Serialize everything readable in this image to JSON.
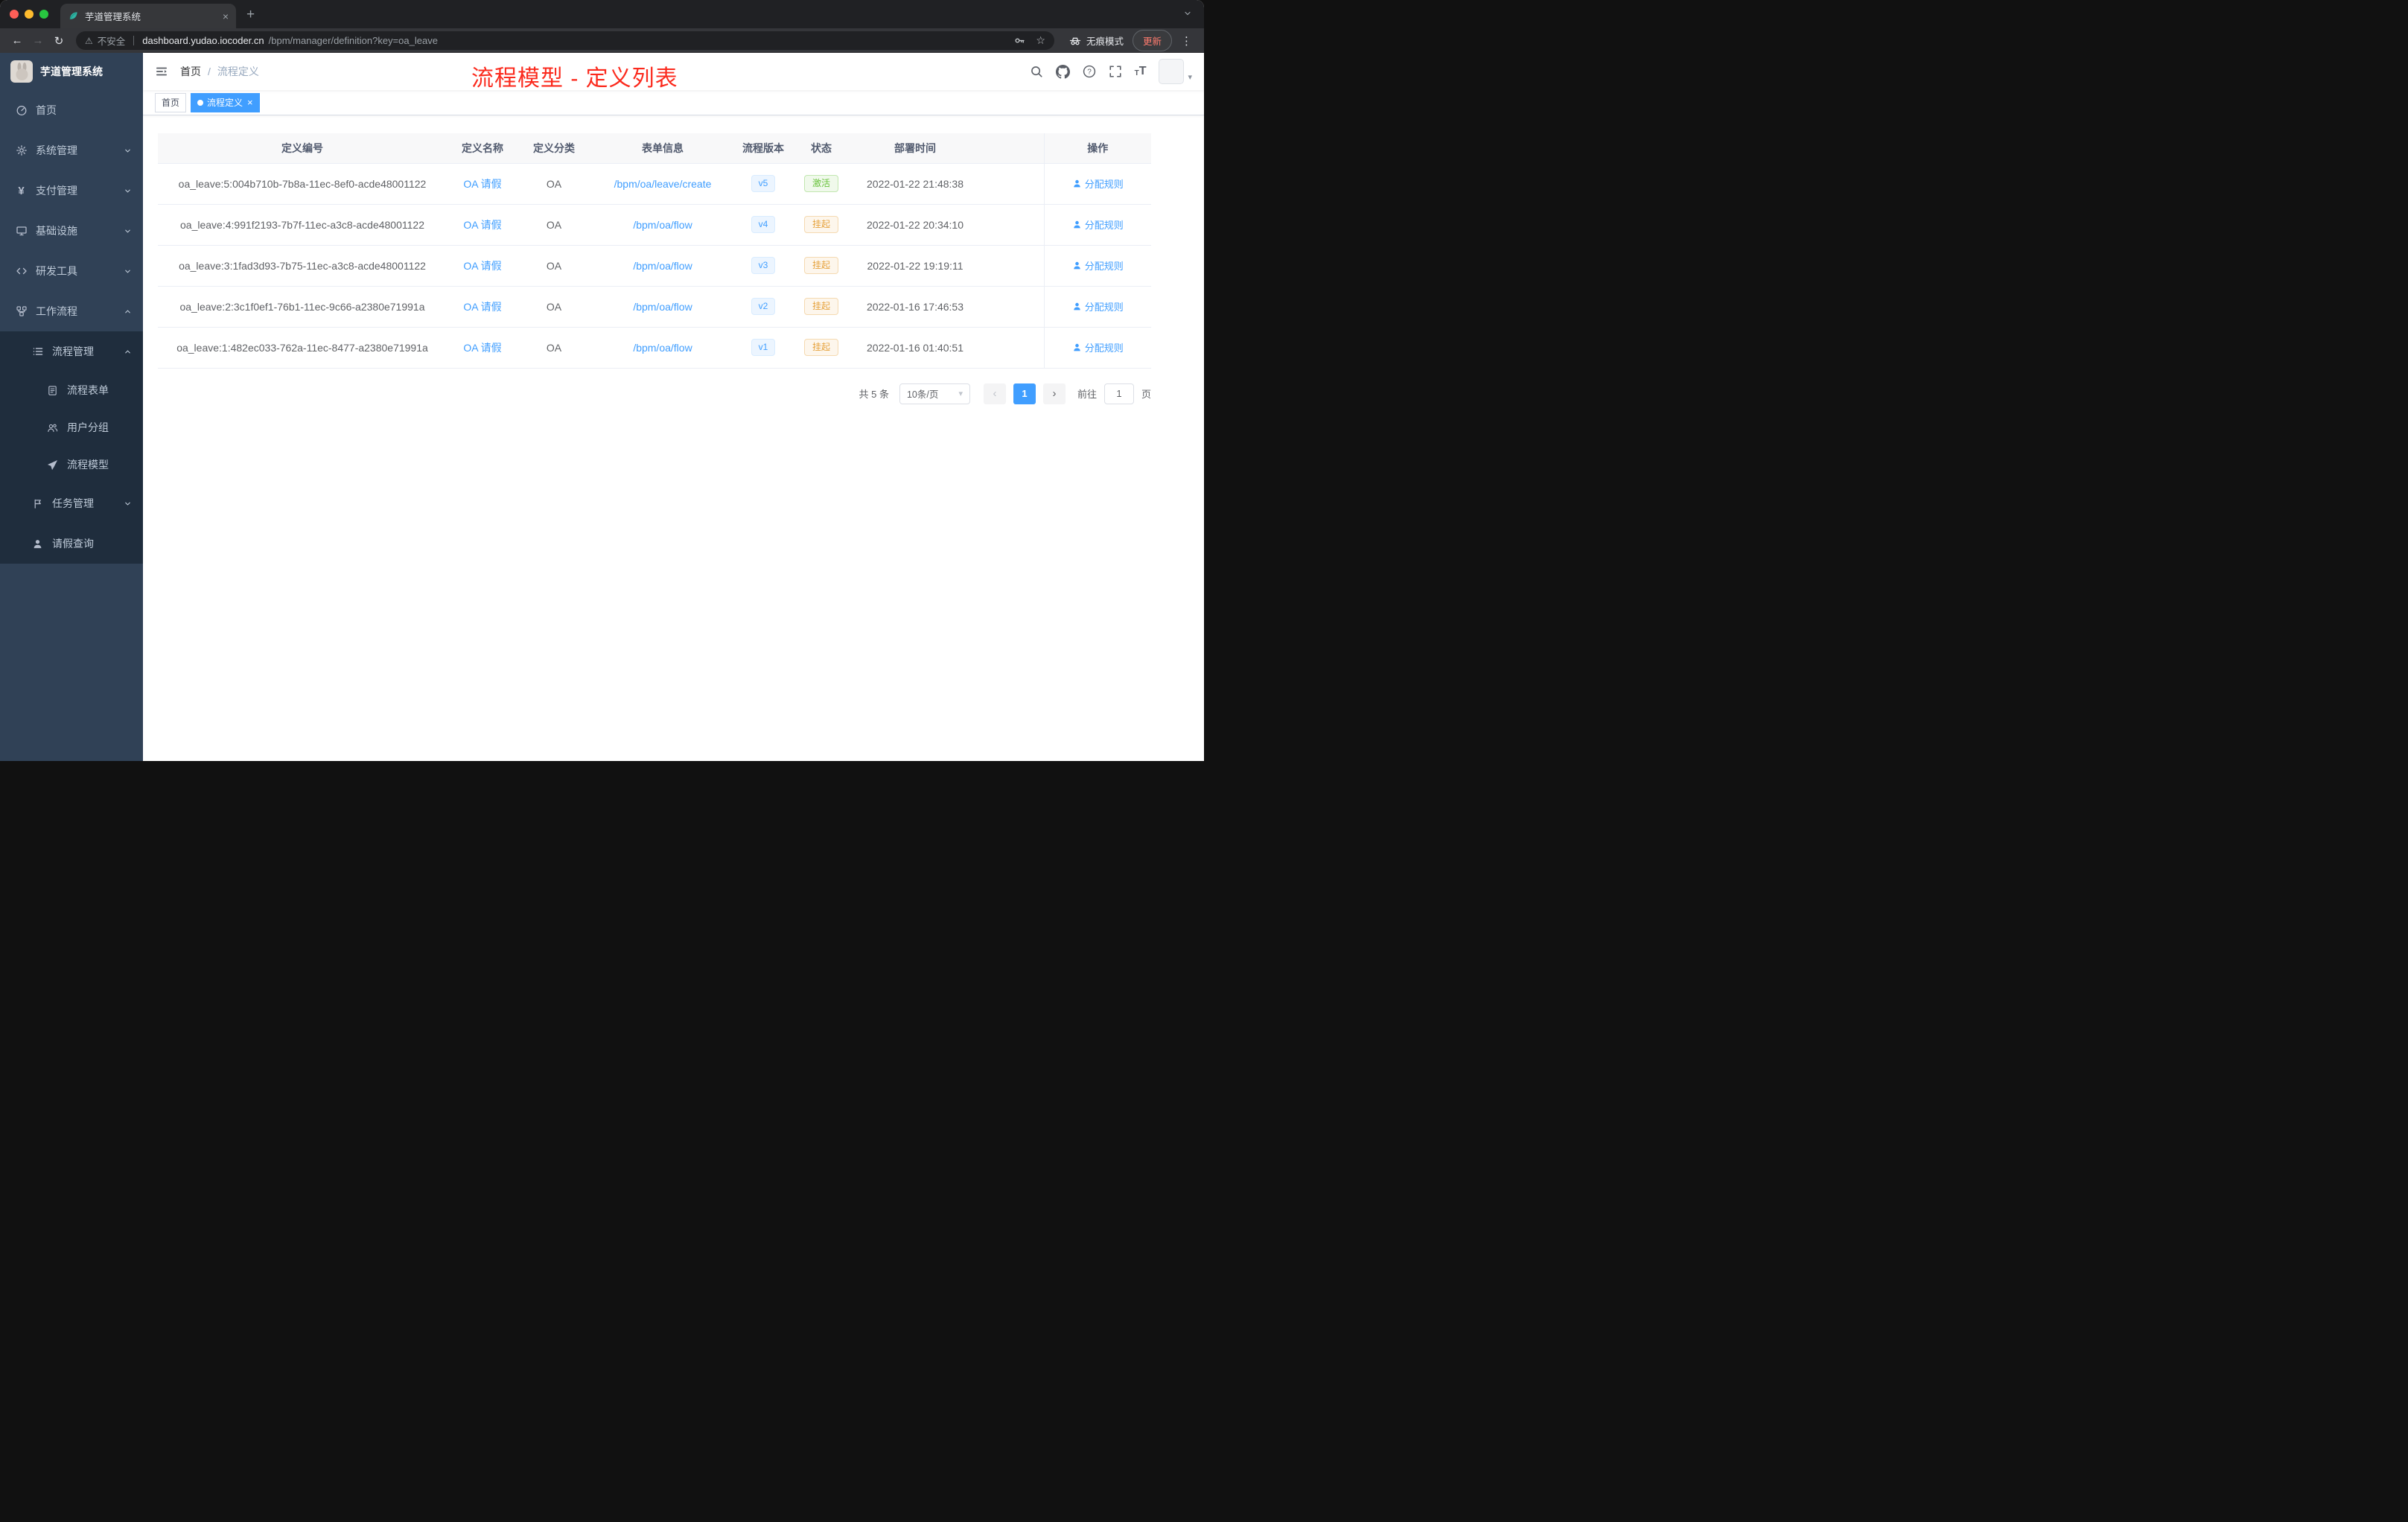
{
  "colors": {
    "primary": "#409eff",
    "annotation": "#fb2a1d",
    "sidebar_bg": "#304156",
    "submenu_bg": "#1f2d3d",
    "success_text": "#67c23a",
    "warning_text": "#e6a23c"
  },
  "glyphs": {
    "back": "←",
    "forward": "→",
    "reload": "↻",
    "warning": "⚠",
    "star": "☆",
    "kebab": "⋮",
    "new_tab": "+",
    "close": "×",
    "caret_down": "▾",
    "page_prev": "‹",
    "page_next": "›",
    "question": "?",
    "yen": "¥",
    "t_small": "T",
    "t_big": "T"
  },
  "browser": {
    "tab_title": "芋道管理系统",
    "security_label": "不安全",
    "url_domain": "dashboard.yudao.iocoder.cn",
    "url_path": "/bpm/manager/definition?key=oa_leave",
    "incognito_label": "无痕模式",
    "update_label": "更新"
  },
  "sidebar": {
    "logo_title": "芋道管理系统",
    "items": [
      {
        "label": "首页"
      },
      {
        "label": "系统管理"
      },
      {
        "label": "支付管理"
      },
      {
        "label": "基础设施"
      },
      {
        "label": "研发工具"
      },
      {
        "label": "工作流程"
      },
      {
        "label": "流程管理"
      },
      {
        "label": "流程表单"
      },
      {
        "label": "用户分组"
      },
      {
        "label": "流程模型"
      },
      {
        "label": "任务管理"
      },
      {
        "label": "请假查询"
      }
    ]
  },
  "navbar": {
    "breadcrumb_home": "首页",
    "breadcrumb_sep": "/",
    "breadcrumb_current": "流程定义",
    "annotation": "流程模型 - 定义列表"
  },
  "tags": {
    "home": "首页",
    "active": "流程定义"
  },
  "table": {
    "headers": {
      "id": "定义编号",
      "name": "定义名称",
      "category": "定义分类",
      "form": "表单信息",
      "version": "流程版本",
      "status": "状态",
      "deploy_time": "部署时间",
      "actions": "操作"
    },
    "action_label": "分配规则",
    "rows": [
      {
        "id": "oa_leave:5:004b710b-7b8a-11ec-8ef0-acde48001122",
        "name": "OA 请假",
        "category": "OA",
        "form": "/bpm/oa/leave/create",
        "version": "v5",
        "status": "激活",
        "deploy_time": "2022-01-22 21:48:38"
      },
      {
        "id": "oa_leave:4:991f2193-7b7f-11ec-a3c8-acde48001122",
        "name": "OA 请假",
        "category": "OA",
        "form": "/bpm/oa/flow",
        "version": "v4",
        "status": "挂起",
        "deploy_time": "2022-01-22 20:34:10"
      },
      {
        "id": "oa_leave:3:1fad3d93-7b75-11ec-a3c8-acde48001122",
        "name": "OA 请假",
        "category": "OA",
        "form": "/bpm/oa/flow",
        "version": "v3",
        "status": "挂起",
        "deploy_time": "2022-01-22 19:19:11"
      },
      {
        "id": "oa_leave:2:3c1f0ef1-76b1-11ec-9c66-a2380e71991a",
        "name": "OA 请假",
        "category": "OA",
        "form": "/bpm/oa/flow",
        "version": "v2",
        "status": "挂起",
        "deploy_time": "2022-01-16 17:46:53"
      },
      {
        "id": "oa_leave:1:482ec033-762a-11ec-8477-a2380e71991a",
        "name": "OA 请假",
        "category": "OA",
        "form": "/bpm/oa/flow",
        "version": "v1",
        "status": "挂起",
        "deploy_time": "2022-01-16 01:40:51"
      }
    ]
  },
  "pagination": {
    "total": "共 5 条",
    "page_size": "10条/页",
    "page": "1",
    "goto": "前往",
    "goto_value": "1",
    "unit": "页"
  }
}
